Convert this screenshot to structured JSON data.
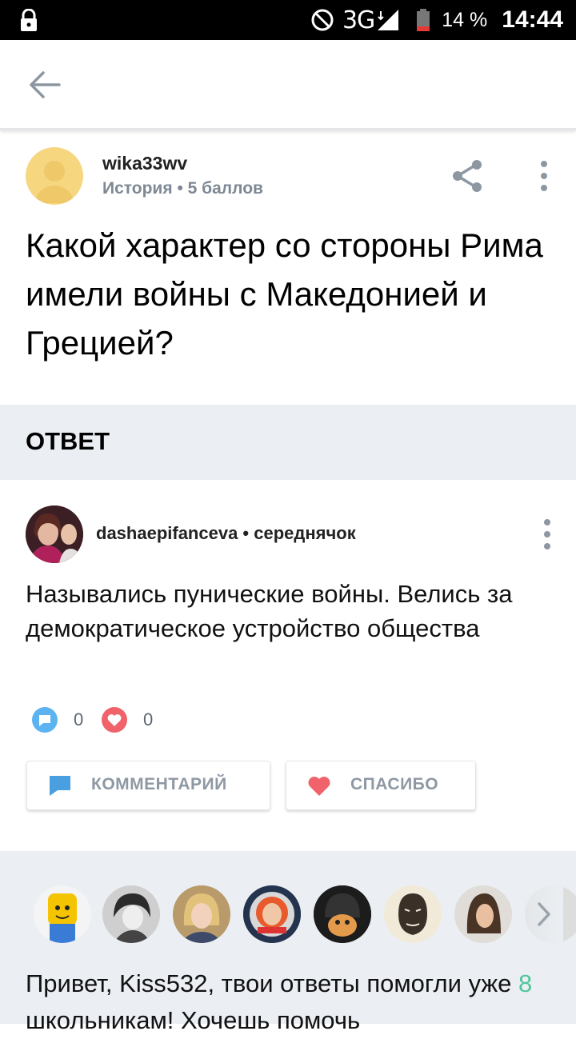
{
  "status_bar": {
    "network": "3G",
    "battery": "14 %",
    "time": "14:44"
  },
  "question": {
    "username": "wika33wv",
    "subject": "История",
    "points": "5 баллов",
    "separator": " • ",
    "text": "Какой характер со стороны Рима имели войны с Македонией и Грецией?"
  },
  "answer_header": "ОТВЕТ",
  "answer": {
    "username": "dashaepifanceva",
    "separator": " • ",
    "rank": "середнячок",
    "text": "Назывались пунические войны. Велись за демократическое устройство общества",
    "comments_count": "0",
    "thanks_count": "0",
    "comment_button": "КОММЕНТАРИЙ",
    "thanks_button": "СПАСИБО"
  },
  "promo": {
    "part1": "Привет, Kiss532, твои ответы помогли уже ",
    "count": "8",
    "part2": " школьникам! Хочешь помочь"
  },
  "colors": {
    "accent_green": "#4fc79a",
    "section_bg": "#ebeff3",
    "comment_blue": "#5bb4f0",
    "thanks_red": "#f0636b"
  },
  "icons": [
    "lock-icon",
    "dnd-icon",
    "signal-icon",
    "battery-icon",
    "back-arrow-icon",
    "share-icon",
    "more-vert-icon",
    "comment-icon",
    "heart-icon",
    "chevron-right-icon"
  ]
}
